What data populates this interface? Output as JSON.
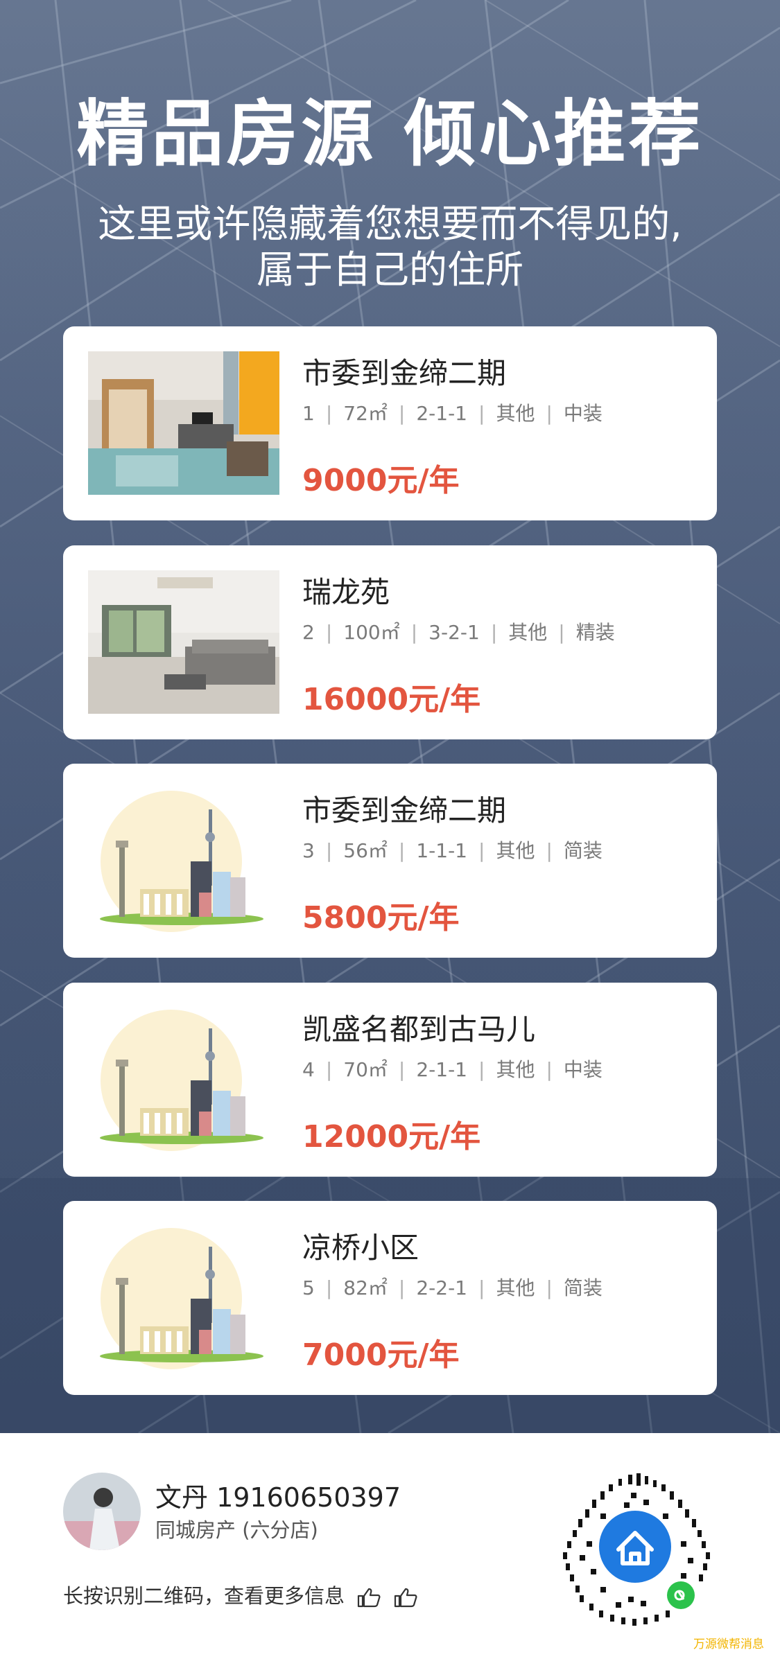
{
  "hero": {
    "title": "精品房源 倾心推荐",
    "subtitle_line1": "这里或许隐藏着您想要而不得见的,",
    "subtitle_line2": "属于自己的住所"
  },
  "listings": [
    {
      "name": "市委到金缔二期",
      "number": "1",
      "area": "72㎡",
      "layout": "2-1-1",
      "type": "其他",
      "decoration": "中装",
      "price": "9000元/年",
      "image": "photo-living-room"
    },
    {
      "name": "瑞龙苑",
      "number": "2",
      "area": "100㎡",
      "layout": "3-2-1",
      "type": "其他",
      "decoration": "精装",
      "price": "16000元/年",
      "image": "photo-living-room-sofa"
    },
    {
      "name": "市委到金缔二期",
      "number": "3",
      "area": "56㎡",
      "layout": "1-1-1",
      "type": "其他",
      "decoration": "简装",
      "price": "5800元/年",
      "image": "city-placeholder-illustration"
    },
    {
      "name": "凯盛名都到古马儿",
      "number": "4",
      "area": "70㎡",
      "layout": "2-1-1",
      "type": "其他",
      "decoration": "中装",
      "price": "12000元/年",
      "image": "city-placeholder-illustration"
    },
    {
      "name": "凉桥小区",
      "number": "5",
      "area": "82㎡",
      "layout": "2-2-1",
      "type": "其他",
      "decoration": "简装",
      "price": "7000元/年",
      "image": "city-placeholder-illustration"
    }
  ],
  "agent": {
    "name_phone": "文丹 19160650397",
    "store": "同城房产 (六分店)",
    "scan_hint": "长按识别二维码，查看更多信息"
  },
  "watermark": "万源微帮消息",
  "colors": {
    "price": "#e3553f",
    "hero_bg": "#5b6c89",
    "qr_badge": "#1f7ae0",
    "wechat_green": "#2bc24b"
  },
  "icons": [
    "thumbs-up-icon",
    "house-icon",
    "mini-program-icon"
  ]
}
